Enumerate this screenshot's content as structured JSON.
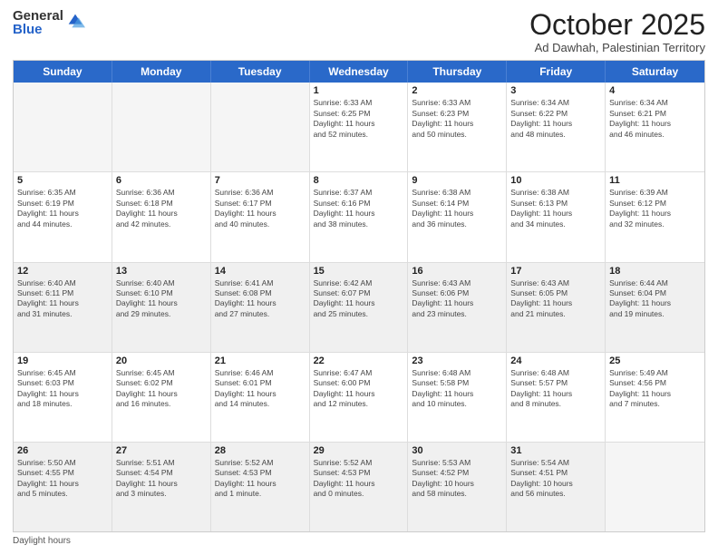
{
  "logo": {
    "general": "General",
    "blue": "Blue"
  },
  "title": "October 2025",
  "subtitle": "Ad Dawhah, Palestinian Territory",
  "days": [
    "Sunday",
    "Monday",
    "Tuesday",
    "Wednesday",
    "Thursday",
    "Friday",
    "Saturday"
  ],
  "weeks": [
    [
      {
        "day": "",
        "info": "",
        "empty": true
      },
      {
        "day": "",
        "info": "",
        "empty": true
      },
      {
        "day": "",
        "info": "",
        "empty": true
      },
      {
        "day": "1",
        "info": "Sunrise: 6:33 AM\nSunset: 6:25 PM\nDaylight: 11 hours\nand 52 minutes."
      },
      {
        "day": "2",
        "info": "Sunrise: 6:33 AM\nSunset: 6:23 PM\nDaylight: 11 hours\nand 50 minutes."
      },
      {
        "day": "3",
        "info": "Sunrise: 6:34 AM\nSunset: 6:22 PM\nDaylight: 11 hours\nand 48 minutes."
      },
      {
        "day": "4",
        "info": "Sunrise: 6:34 AM\nSunset: 6:21 PM\nDaylight: 11 hours\nand 46 minutes."
      }
    ],
    [
      {
        "day": "5",
        "info": "Sunrise: 6:35 AM\nSunset: 6:19 PM\nDaylight: 11 hours\nand 44 minutes."
      },
      {
        "day": "6",
        "info": "Sunrise: 6:36 AM\nSunset: 6:18 PM\nDaylight: 11 hours\nand 42 minutes."
      },
      {
        "day": "7",
        "info": "Sunrise: 6:36 AM\nSunset: 6:17 PM\nDaylight: 11 hours\nand 40 minutes."
      },
      {
        "day": "8",
        "info": "Sunrise: 6:37 AM\nSunset: 6:16 PM\nDaylight: 11 hours\nand 38 minutes."
      },
      {
        "day": "9",
        "info": "Sunrise: 6:38 AM\nSunset: 6:14 PM\nDaylight: 11 hours\nand 36 minutes."
      },
      {
        "day": "10",
        "info": "Sunrise: 6:38 AM\nSunset: 6:13 PM\nDaylight: 11 hours\nand 34 minutes."
      },
      {
        "day": "11",
        "info": "Sunrise: 6:39 AM\nSunset: 6:12 PM\nDaylight: 11 hours\nand 32 minutes."
      }
    ],
    [
      {
        "day": "12",
        "info": "Sunrise: 6:40 AM\nSunset: 6:11 PM\nDaylight: 11 hours\nand 31 minutes.",
        "shaded": true
      },
      {
        "day": "13",
        "info": "Sunrise: 6:40 AM\nSunset: 6:10 PM\nDaylight: 11 hours\nand 29 minutes.",
        "shaded": true
      },
      {
        "day": "14",
        "info": "Sunrise: 6:41 AM\nSunset: 6:08 PM\nDaylight: 11 hours\nand 27 minutes.",
        "shaded": true
      },
      {
        "day": "15",
        "info": "Sunrise: 6:42 AM\nSunset: 6:07 PM\nDaylight: 11 hours\nand 25 minutes.",
        "shaded": true
      },
      {
        "day": "16",
        "info": "Sunrise: 6:43 AM\nSunset: 6:06 PM\nDaylight: 11 hours\nand 23 minutes.",
        "shaded": true
      },
      {
        "day": "17",
        "info": "Sunrise: 6:43 AM\nSunset: 6:05 PM\nDaylight: 11 hours\nand 21 minutes.",
        "shaded": true
      },
      {
        "day": "18",
        "info": "Sunrise: 6:44 AM\nSunset: 6:04 PM\nDaylight: 11 hours\nand 19 minutes.",
        "shaded": true
      }
    ],
    [
      {
        "day": "19",
        "info": "Sunrise: 6:45 AM\nSunset: 6:03 PM\nDaylight: 11 hours\nand 18 minutes."
      },
      {
        "day": "20",
        "info": "Sunrise: 6:45 AM\nSunset: 6:02 PM\nDaylight: 11 hours\nand 16 minutes."
      },
      {
        "day": "21",
        "info": "Sunrise: 6:46 AM\nSunset: 6:01 PM\nDaylight: 11 hours\nand 14 minutes."
      },
      {
        "day": "22",
        "info": "Sunrise: 6:47 AM\nSunset: 6:00 PM\nDaylight: 11 hours\nand 12 minutes."
      },
      {
        "day": "23",
        "info": "Sunrise: 6:48 AM\nSunset: 5:58 PM\nDaylight: 11 hours\nand 10 minutes."
      },
      {
        "day": "24",
        "info": "Sunrise: 6:48 AM\nSunset: 5:57 PM\nDaylight: 11 hours\nand 8 minutes."
      },
      {
        "day": "25",
        "info": "Sunrise: 5:49 AM\nSunset: 4:56 PM\nDaylight: 11 hours\nand 7 minutes."
      }
    ],
    [
      {
        "day": "26",
        "info": "Sunrise: 5:50 AM\nSunset: 4:55 PM\nDaylight: 11 hours\nand 5 minutes.",
        "shaded": true
      },
      {
        "day": "27",
        "info": "Sunrise: 5:51 AM\nSunset: 4:54 PM\nDaylight: 11 hours\nand 3 minutes.",
        "shaded": true
      },
      {
        "day": "28",
        "info": "Sunrise: 5:52 AM\nSunset: 4:53 PM\nDaylight: 11 hours\nand 1 minute.",
        "shaded": true
      },
      {
        "day": "29",
        "info": "Sunrise: 5:52 AM\nSunset: 4:53 PM\nDaylight: 11 hours\nand 0 minutes.",
        "shaded": true
      },
      {
        "day": "30",
        "info": "Sunrise: 5:53 AM\nSunset: 4:52 PM\nDaylight: 10 hours\nand 58 minutes.",
        "shaded": true
      },
      {
        "day": "31",
        "info": "Sunrise: 5:54 AM\nSunset: 4:51 PM\nDaylight: 10 hours\nand 56 minutes.",
        "shaded": true
      },
      {
        "day": "",
        "info": "",
        "empty": true,
        "shaded": false
      }
    ]
  ],
  "footer": "Daylight hours"
}
